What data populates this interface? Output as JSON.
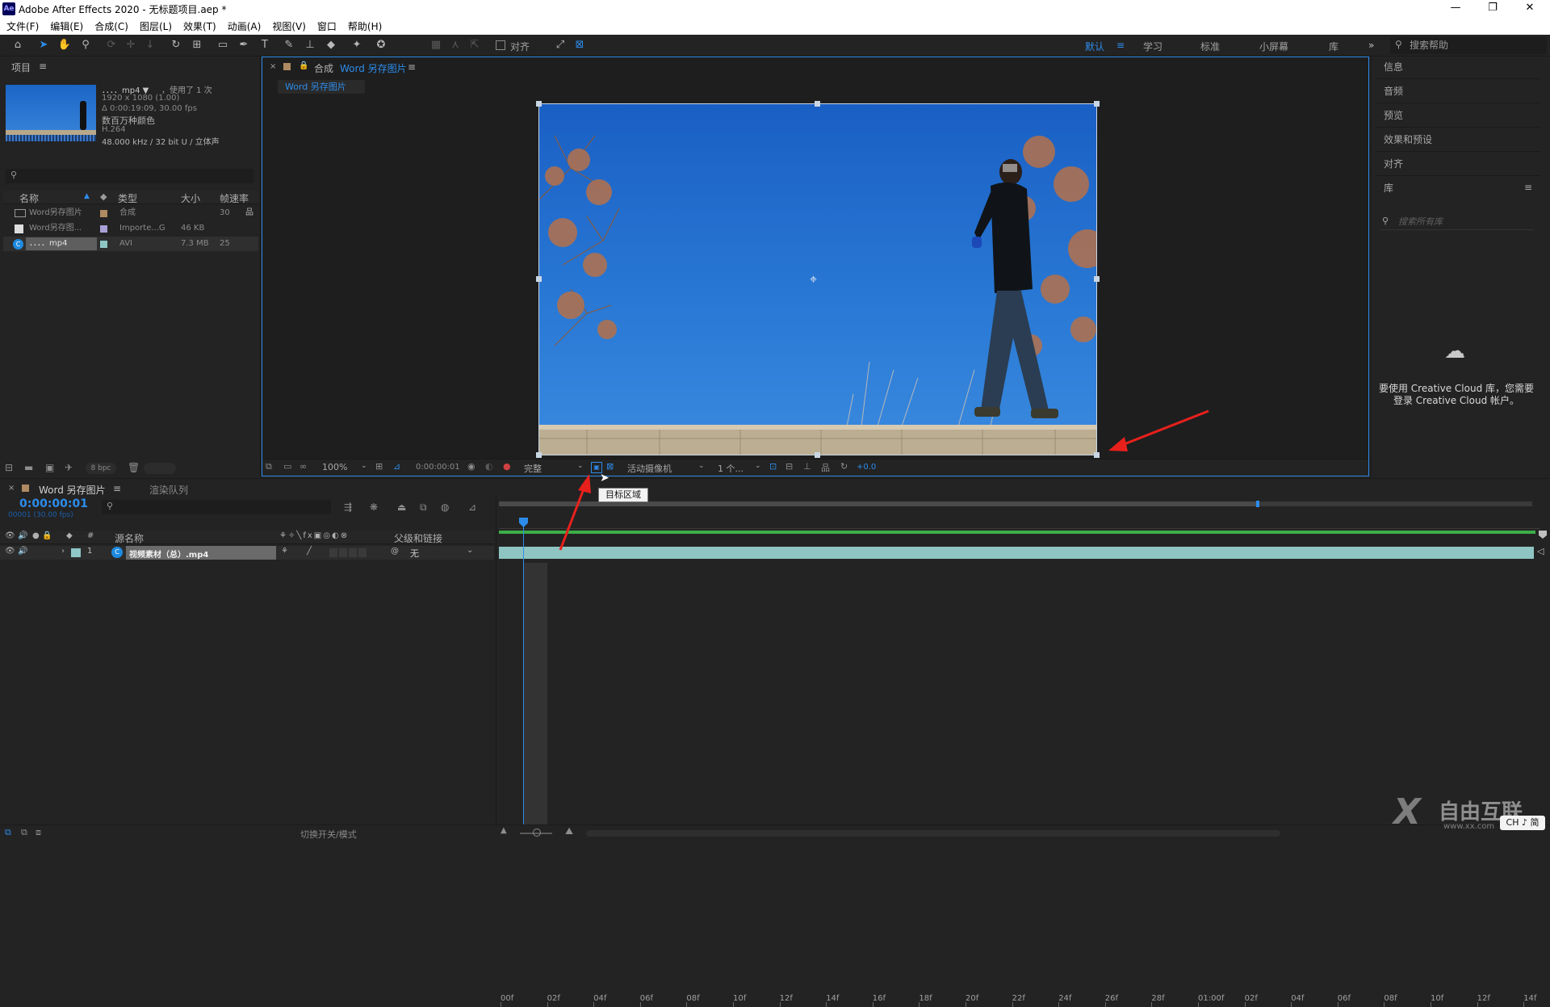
{
  "window": {
    "title": "Adobe After Effects 2020 - 无标题项目.aep *",
    "logo": "Ae",
    "min": "—",
    "restore": "❐",
    "close": "✕"
  },
  "menu": [
    "文件(F)",
    "编辑(E)",
    "合成(C)",
    "图层(L)",
    "效果(T)",
    "动画(A)",
    "视图(V)",
    "窗口",
    "帮助(H)"
  ],
  "toolbar": {
    "snap_label": "对齐",
    "workspaces": [
      "默认",
      "学习",
      "标准",
      "小屏幕",
      "库"
    ],
    "active_workspace": "默认",
    "more": "»",
    "search_placeholder": "搜索帮助"
  },
  "project": {
    "title": "项目",
    "footage_name": "．．．．mp4 ▼",
    "used": "，使用了 1 次",
    "info": [
      "1920 x 1080 (1.00)",
      "Δ 0:00:19:09, 30.00 fps",
      "数百万种颜色",
      "H.264",
      "48.000 kHz / 32 bit U / 立体声"
    ],
    "columns": [
      "名称",
      "类型",
      "大小",
      "帧速率"
    ],
    "items": [
      {
        "name": "Word另存图片",
        "type": "合成",
        "size": "",
        "fps": "30",
        "color": "#b08a62"
      },
      {
        "name": "Word另存图...",
        "type": "Importe...G",
        "size": "46 KB",
        "fps": "",
        "color": "#a9a0d6"
      },
      {
        "name": "．．．．mp4",
        "type": "AVI",
        "size": "7.3 MB",
        "fps": "25",
        "color": "#8fc7c7"
      }
    ],
    "bpc": "8 bpc"
  },
  "composition": {
    "tab_prefix": "合成",
    "name": "Word 另存图片",
    "flowchart_tab": "Word 另存图片",
    "zoom": "100%",
    "timecode": "0:00:00:01",
    "resolution": "完整",
    "camera": "活动摄像机",
    "views": "1 个...",
    "exposure": "+0.0",
    "tooltip": "目标区域"
  },
  "right_panels": {
    "items": [
      "信息",
      "音频",
      "预览",
      "效果和预设",
      "对齐"
    ],
    "library_title": "库",
    "library_search": "搜索所有库",
    "cc_message": "要使用 Creative Cloud 库，您需要登录 Creative Cloud 帐户。"
  },
  "timeline": {
    "tab": "Word 另存图片",
    "render_tab": "渲染队列",
    "timecode": "0:00:00:01",
    "frame_info": "00001 (30.00 fps)",
    "col_source": "源名称",
    "col_parent": "父级和链接",
    "layer": {
      "index": "1",
      "name": "视频素材（总）.mp4",
      "parent": "无"
    },
    "ticks": [
      "00f",
      "02f",
      "04f",
      "06f",
      "08f",
      "10f",
      "12f",
      "14f",
      "16f",
      "18f",
      "20f",
      "22f",
      "24f",
      "26f",
      "28f",
      "01:00f",
      "02f",
      "04f",
      "06f",
      "08f",
      "10f",
      "12f",
      "14f"
    ],
    "toggle_label": "切换开关/模式"
  },
  "watermark": {
    "brand": "自由互联",
    "url": "www.xx.com",
    "ime": "CH ♪ 简"
  },
  "colors": {
    "accent": "#2d8ceb",
    "annotation_arrow": "#e8201c",
    "bar": "#8ec4c1"
  }
}
